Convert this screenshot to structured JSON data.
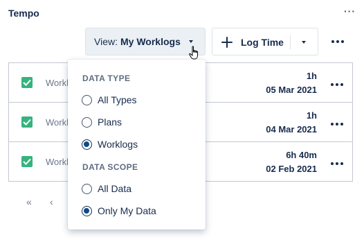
{
  "panel": {
    "title": "Tempo",
    "more_label": "···"
  },
  "toolbar": {
    "view_prefix": "View:",
    "view_value": "My Worklogs",
    "log_time_label": "Log Time"
  },
  "worklogs": [
    {
      "name": "Worklog",
      "duration": "1h",
      "date": "05 Mar 2021",
      "checked": true
    },
    {
      "name": "Worklog",
      "duration": "1h",
      "date": "04 Mar 2021",
      "checked": true
    },
    {
      "name": "Worklog",
      "duration": "6h 40m",
      "date": "02 Feb 2021",
      "checked": true
    }
  ],
  "pagination": {
    "first_label": "«",
    "prev_label": "‹"
  },
  "dropdown": {
    "data_type_title": "DATA TYPE",
    "data_type_options": [
      {
        "label": "All Types",
        "selected": false
      },
      {
        "label": "Plans",
        "selected": false
      },
      {
        "label": "Worklogs",
        "selected": true
      }
    ],
    "data_scope_title": "DATA SCOPE",
    "data_scope_options": [
      {
        "label": "All Data",
        "selected": false
      },
      {
        "label": "Only My Data",
        "selected": true
      }
    ]
  },
  "icons": {
    "more": "more-horizontal-icon",
    "caret": "chevron-down-icon",
    "plus": "plus-icon",
    "check": "checkbox-checked-icon",
    "cursor": "hand-pointer-icon"
  },
  "colors": {
    "accent": "#0c4a8c",
    "check_green": "#36b37e",
    "view_button_bg": "#ebf0f5"
  }
}
